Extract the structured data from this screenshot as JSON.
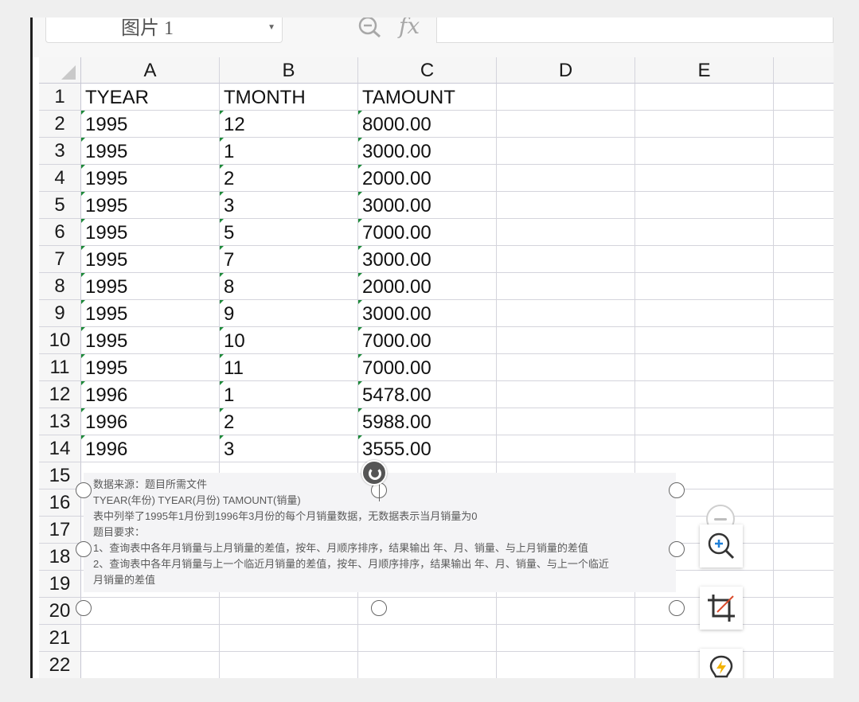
{
  "formula_bar": {
    "name_box": "图片 1",
    "fx_label": "fx",
    "formula_value": ""
  },
  "columns": [
    "A",
    "B",
    "C",
    "D",
    "E"
  ],
  "rows": [
    "1",
    "2",
    "3",
    "4",
    "5",
    "6",
    "7",
    "8",
    "9",
    "10",
    "11",
    "12",
    "13",
    "14",
    "15",
    "16",
    "17",
    "18",
    "19",
    "20",
    "21",
    "22"
  ],
  "table": {
    "headers": [
      "TYEAR",
      "TMONTH",
      "TAMOUNT"
    ],
    "data": [
      [
        "1995",
        "12",
        "8000.00"
      ],
      [
        "1995",
        "1",
        "3000.00"
      ],
      [
        "1995",
        "2",
        "2000.00"
      ],
      [
        "1995",
        "3",
        "3000.00"
      ],
      [
        "1995",
        "5",
        "7000.00"
      ],
      [
        "1995",
        "7",
        "3000.00"
      ],
      [
        "1995",
        "8",
        "2000.00"
      ],
      [
        "1995",
        "9",
        "3000.00"
      ],
      [
        "1995",
        "10",
        "7000.00"
      ],
      [
        "1995",
        "11",
        "7000.00"
      ],
      [
        "1996",
        "1",
        "5478.00"
      ],
      [
        "1996",
        "2",
        "5988.00"
      ],
      [
        "1996",
        "3",
        "3555.00"
      ]
    ]
  },
  "picture": {
    "lines": [
      "数据来源：题目所需文件",
      "TYEAR(年份) TYEAR(月份) TAMOUNT(销量)",
      "表中列举了1995年1月份到1996年3月份的每个月销量数据，无数据表示当月销量为0",
      "题目要求：",
      "1、查询表中各年月销量与上月销量的差值，按年、月顺序排序，结果输出 年、月、销量、与上月销量的差值",
      "2、查询表中各年月销量与上一个临近月销量的差值，按年、月顺序排序，结果输出 年、月、销量、与上一个临近",
      "月销量的差值"
    ]
  },
  "side_tools": {
    "collapse_icon": "minus-circle-icon",
    "zoom_icon": "zoom-in-icon",
    "crop_icon": "crop-icon",
    "smart_icon": "lightning-bulb-icon"
  }
}
